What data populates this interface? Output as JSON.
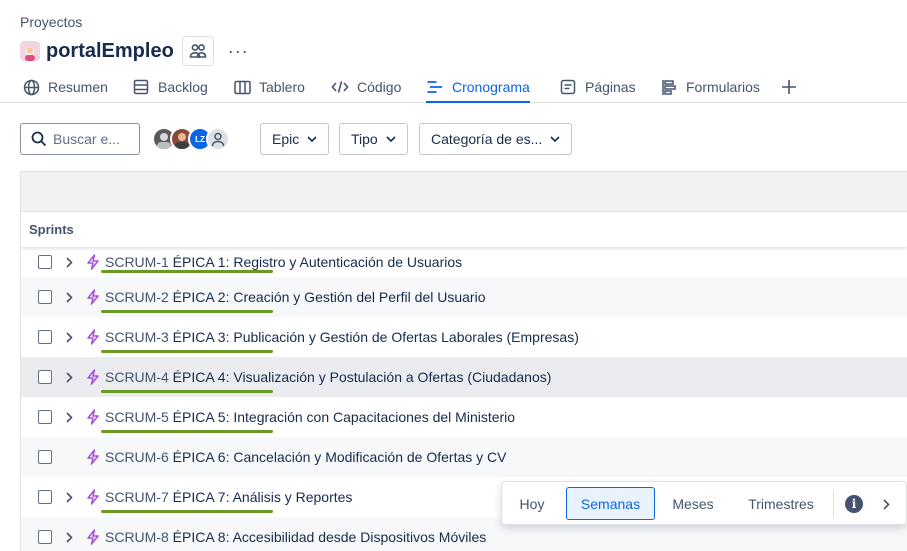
{
  "breadcrumb": "Proyectos",
  "project": {
    "title": "portalEmpleo",
    "more": "···"
  },
  "tabs": [
    {
      "label": "Resumen",
      "icon": "globe-icon"
    },
    {
      "label": "Backlog",
      "icon": "backlog-icon"
    },
    {
      "label": "Tablero",
      "icon": "board-icon"
    },
    {
      "label": "Código",
      "icon": "code-icon"
    },
    {
      "label": "Cronograma",
      "icon": "timeline-icon",
      "active": true
    },
    {
      "label": "Páginas",
      "icon": "pages-icon"
    },
    {
      "label": "Formularios",
      "icon": "forms-icon"
    }
  ],
  "toolbar": {
    "search_placeholder": "Buscar e...",
    "avatar_initials": "LZ",
    "filters": [
      "Epic",
      "Tipo",
      "Categoría de es..."
    ]
  },
  "grid": {
    "sprints_label": "Sprints",
    "rows": [
      {
        "key": "SCRUM-1",
        "title": "ÉPICA 1: Registro y Autenticación de Usuarios",
        "expandable": true,
        "has_bar": true
      },
      {
        "key": "SCRUM-2",
        "title": "ÉPICA 2: Creación y Gestión del Perfil del Usuario",
        "expandable": true,
        "has_bar": true
      },
      {
        "key": "SCRUM-3",
        "title": "ÉPICA 3: Publicación y Gestión de Ofertas Laborales (Empresas)",
        "expandable": true,
        "has_bar": true
      },
      {
        "key": "SCRUM-4",
        "title": "ÉPICA 4: Visualización y Postulación a Ofertas (Ciudadanos)",
        "expandable": true,
        "has_bar": true
      },
      {
        "key": "SCRUM-5",
        "title": "ÉPICA 5: Integración con Capacitaciones del Ministerio",
        "expandable": true,
        "has_bar": true
      },
      {
        "key": "SCRUM-6",
        "title": "ÉPICA 6: Cancelación y Modificación de Ofertas y CV",
        "expandable": false,
        "has_bar": false
      },
      {
        "key": "SCRUM-7",
        "title": "ÉPICA 7: Análisis y Reportes",
        "expandable": true,
        "has_bar": true
      },
      {
        "key": "SCRUM-8",
        "title": "ÉPICA 8: Accesibilidad desde Dispositivos Móviles",
        "expandable": true,
        "has_bar": false
      }
    ]
  },
  "scale": {
    "today": "Hoy",
    "weeks": "Semanas",
    "months": "Meses",
    "quarters": "Trimestres",
    "active": "Semanas"
  },
  "colors": {
    "accent": "#0c66e4",
    "epic": "#a54ee0",
    "bar": "#6a9a23"
  }
}
